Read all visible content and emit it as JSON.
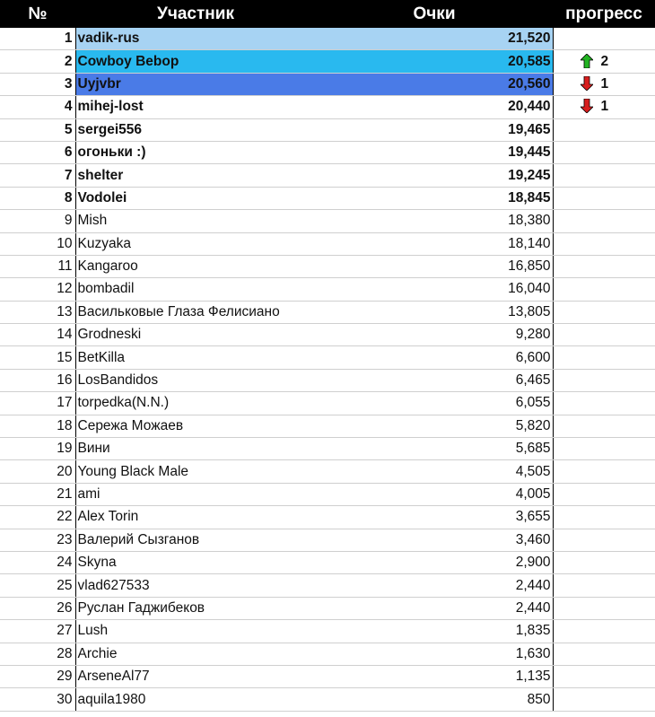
{
  "header": {
    "col_num": "№",
    "col_name": "Участник",
    "col_points": "Очки",
    "col_progress": "прогресс"
  },
  "colors": {
    "header_bg": "#000000",
    "highlight_1": "#a7d3f3",
    "highlight_2": "#29b9ef",
    "highlight_3": "#4a7be7",
    "arrow_up": "#22b422",
    "arrow_down": "#d81e1e"
  },
  "rows": [
    {
      "num": "1",
      "name": "vadik-rus",
      "points": "21,520",
      "progress_dir": "",
      "progress": ""
    },
    {
      "num": "2",
      "name": "Cowboy Bebop",
      "points": "20,585",
      "progress_dir": "up",
      "progress": "2"
    },
    {
      "num": "3",
      "name": "Uyjvbr",
      "points": "20,560",
      "progress_dir": "down",
      "progress": "1"
    },
    {
      "num": "4",
      "name": "mihej-lost",
      "points": "20,440",
      "progress_dir": "down",
      "progress": "1"
    },
    {
      "num": "5",
      "name": "sergei556",
      "points": "19,465",
      "progress_dir": "",
      "progress": ""
    },
    {
      "num": "6",
      "name": "огоньки :)",
      "points": "19,445",
      "progress_dir": "",
      "progress": ""
    },
    {
      "num": "7",
      "name": "shelter",
      "points": "19,245",
      "progress_dir": "",
      "progress": ""
    },
    {
      "num": "8",
      "name": "Vodolei",
      "points": "18,845",
      "progress_dir": "",
      "progress": ""
    },
    {
      "num": "9",
      "name": "Mish",
      "points": "18,380",
      "progress_dir": "",
      "progress": ""
    },
    {
      "num": "10",
      "name": "Kuzyaka",
      "points": "18,140",
      "progress_dir": "",
      "progress": ""
    },
    {
      "num": "11",
      "name": "Kangaroo",
      "points": "16,850",
      "progress_dir": "",
      "progress": ""
    },
    {
      "num": "12",
      "name": "bombadil",
      "points": "16,040",
      "progress_dir": "",
      "progress": ""
    },
    {
      "num": "13",
      "name": "Васильковые Глаза Фелисиано",
      "points": "13,805",
      "progress_dir": "",
      "progress": ""
    },
    {
      "num": "14",
      "name": "Grodneski",
      "points": "9,280",
      "progress_dir": "",
      "progress": ""
    },
    {
      "num": "15",
      "name": "BetKilla",
      "points": "6,600",
      "progress_dir": "",
      "progress": ""
    },
    {
      "num": "16",
      "name": "LosBandidos",
      "points": "6,465",
      "progress_dir": "",
      "progress": ""
    },
    {
      "num": "17",
      "name": "torpedka(N.N.)",
      "points": "6,055",
      "progress_dir": "",
      "progress": ""
    },
    {
      "num": "18",
      "name": "Сережа Можаев",
      "points": "5,820",
      "progress_dir": "",
      "progress": ""
    },
    {
      "num": "19",
      "name": "Вини",
      "points": "5,685",
      "progress_dir": "",
      "progress": ""
    },
    {
      "num": "20",
      "name": "Young Black Male",
      "points": "4,505",
      "progress_dir": "",
      "progress": ""
    },
    {
      "num": "21",
      "name": "ami",
      "points": "4,005",
      "progress_dir": "",
      "progress": ""
    },
    {
      "num": "22",
      "name": "Alex Torin",
      "points": "3,655",
      "progress_dir": "",
      "progress": ""
    },
    {
      "num": "23",
      "name": "Валерий Сызганов",
      "points": "3,460",
      "progress_dir": "",
      "progress": ""
    },
    {
      "num": "24",
      "name": "Skyna",
      "points": "2,900",
      "progress_dir": "",
      "progress": ""
    },
    {
      "num": "25",
      "name": "vlad627533",
      "points": "2,440",
      "progress_dir": "",
      "progress": ""
    },
    {
      "num": "26",
      "name": "Руслан Гаджибеков",
      "points": "2,440",
      "progress_dir": "",
      "progress": ""
    },
    {
      "num": "27",
      "name": "Lush",
      "points": "1,835",
      "progress_dir": "",
      "progress": ""
    },
    {
      "num": "28",
      "name": "Archie",
      "points": "1,630",
      "progress_dir": "",
      "progress": ""
    },
    {
      "num": "29",
      "name": "ArseneAl77",
      "points": "1,135",
      "progress_dir": "",
      "progress": ""
    },
    {
      "num": "30",
      "name": "aquila1980",
      "points": "850",
      "progress_dir": "",
      "progress": ""
    }
  ]
}
